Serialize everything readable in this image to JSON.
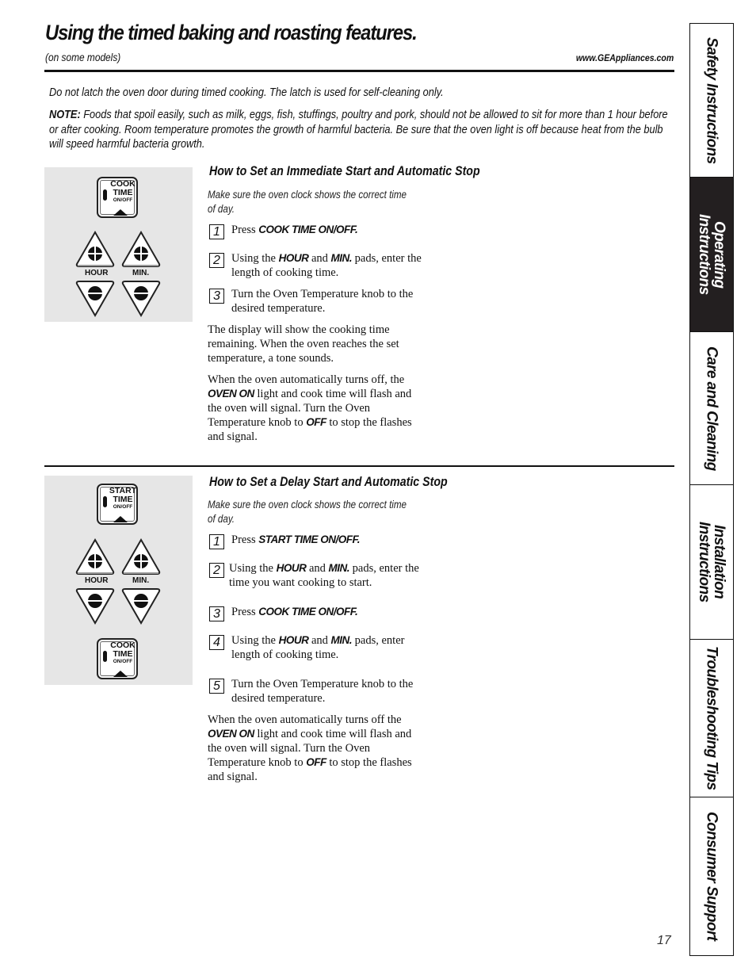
{
  "header": {
    "title": "Using the timed baking and roasting features.",
    "subtitle": "(on some models)",
    "url": "www.GEAppliances.com"
  },
  "intro": {
    "warning": "Do not latch the oven door during timed cooking. The latch is used for self-cleaning only.",
    "note_label": "NOTE:",
    "note_text": " Foods that spoil easily, such as milk, eggs, fish, stuffings, poultry and pork, should not be allowed to sit for more than 1 hour before or after cooking. Room temperature promotes the growth of harmful bacteria. Be sure that the oven light is off because heat from the bulb will speed harmful bacteria growth."
  },
  "control_pad": {
    "cook_time": {
      "line1": "COOK",
      "line2": "TIME",
      "line3": "ON/OFF"
    },
    "start_time": {
      "line1": "START",
      "line2": "TIME",
      "line3": "ON/OFF"
    },
    "hour_label": "HOUR",
    "min_label": "MIN."
  },
  "section1": {
    "heading": "How to Set an Immediate Start and Automatic Stop",
    "hint": "Make sure the oven clock shows the correct time of day.",
    "steps": [
      {
        "num": "1",
        "pre": "Press ",
        "bold1": "COOK TIME ON/OFF.",
        "mid": "",
        "bold2": "",
        "post": ""
      },
      {
        "num": "2",
        "pre": "Using the ",
        "bold1": "HOUR",
        "mid": " and ",
        "bold2": "MIN.",
        "post": " pads, enter the length of cooking time."
      },
      {
        "num": "3",
        "pre": "Turn the Oven Temperature knob to the desired temperature.",
        "bold1": "",
        "mid": "",
        "bold2": "",
        "post": ""
      }
    ],
    "para1": "The display will show the cooking time remaining. When the oven reaches the set temperature, a tone sounds.",
    "para2": {
      "pre": "When the oven automatically turns off, the ",
      "bold1": "OVEN ON",
      "mid": " light and cook time will flash and the oven will signal. Turn the Oven Temperature knob to ",
      "bold2": "OFF",
      "post": " to stop the flashes and signal."
    }
  },
  "section2": {
    "heading": "How to Set a Delay Start and Automatic Stop",
    "hint": "Make sure the oven clock shows the correct time of day.",
    "steps": [
      {
        "num": "1",
        "pre": "Press ",
        "bold1": "START TIME ON/OFF.",
        "mid": "",
        "bold2": "",
        "post": ""
      },
      {
        "num": "2",
        "pre": "Using the ",
        "bold1": "HOUR",
        "mid": " and ",
        "bold2": "MIN.",
        "post": " pads, enter the time you want cooking to start."
      },
      {
        "num": "3",
        "pre": "Press ",
        "bold1": "COOK TIME ON/OFF.",
        "mid": "",
        "bold2": "",
        "post": ""
      },
      {
        "num": "4",
        "pre": "Using the ",
        "bold1": "HOUR",
        "mid": " and ",
        "bold2": "MIN.",
        "post": " pads, enter length of cooking time."
      },
      {
        "num": "5",
        "pre": "Turn the Oven Temperature knob to the desired temperature.",
        "bold1": "",
        "mid": "",
        "bold2": "",
        "post": ""
      }
    ],
    "para1": {
      "pre": "When the oven automatically turns off the ",
      "bold1": "OVEN ON",
      "mid": " light and cook time will flash and the oven will signal. Turn the Oven Temperature knob to ",
      "bold2": "OFF",
      "post": " to stop the flashes and signal."
    }
  },
  "side_tabs": [
    {
      "label": "Safety Instructions",
      "active": false
    },
    {
      "label": "Operating\nInstructions",
      "active": true
    },
    {
      "label": "Care and Cleaning",
      "active": false
    },
    {
      "label": "Installation\nInstructions",
      "active": false
    },
    {
      "label": "Troubleshooting Tips",
      "active": false
    },
    {
      "label": "Consumer Support",
      "active": false
    }
  ],
  "page_number": "17",
  "colors": {
    "active_tab_bg": "#231f20",
    "panel_bg": "#e6e6e6"
  }
}
